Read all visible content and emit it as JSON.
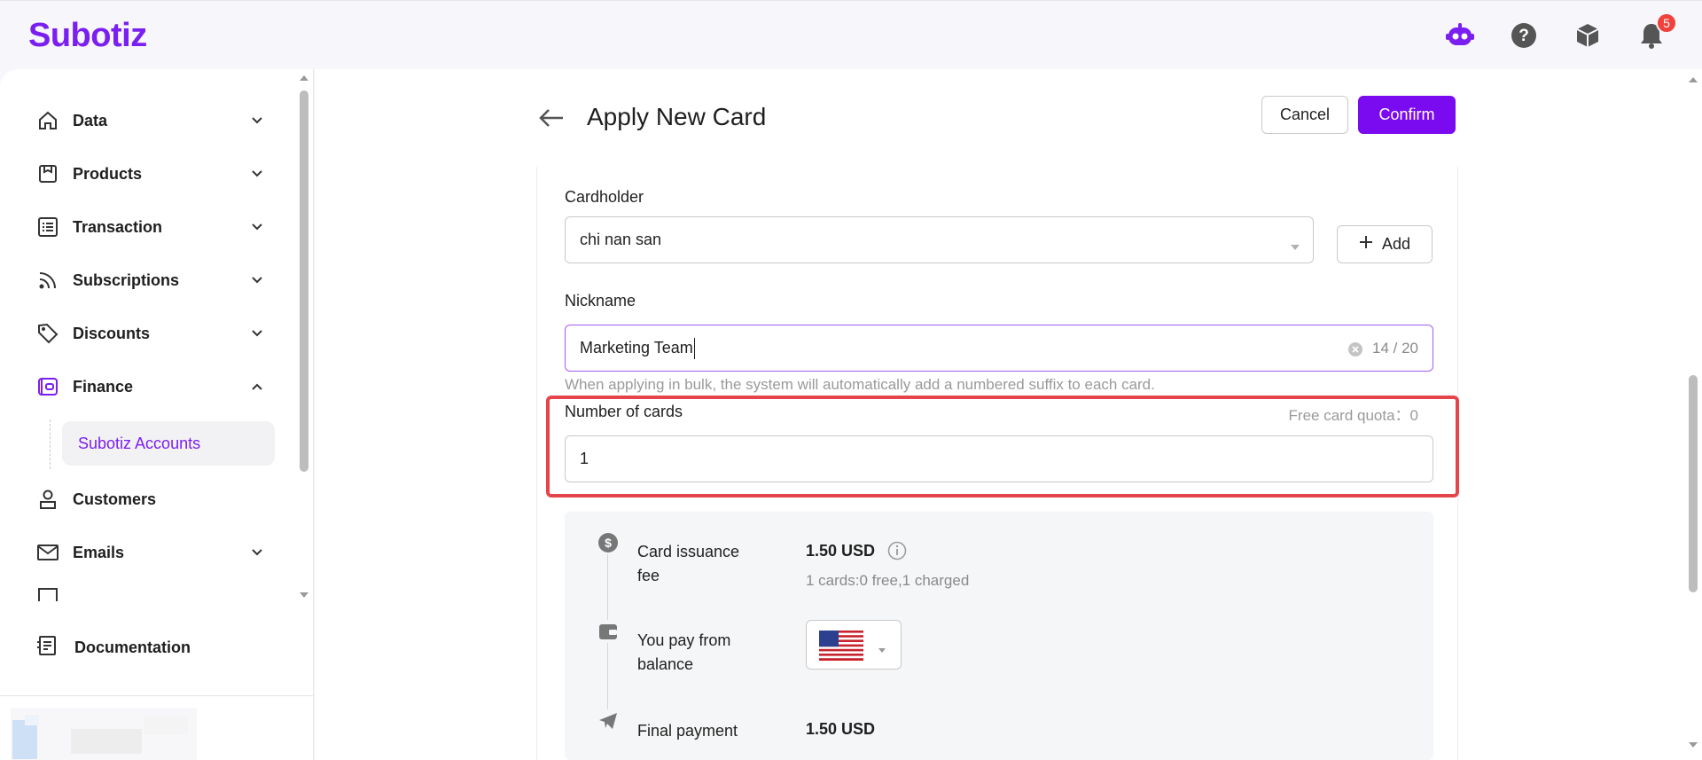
{
  "header": {
    "logo": "Subotiz",
    "notification_count": "5",
    "accent_color": "#7a1ff0",
    "icons": [
      "assistant-bot-icon",
      "help-icon",
      "package-icon",
      "bell-icon"
    ]
  },
  "sidebar": {
    "items": [
      {
        "label": "Data",
        "icon": "home-icon"
      },
      {
        "label": "Products",
        "icon": "store-icon"
      },
      {
        "label": "Transaction",
        "icon": "list-icon"
      },
      {
        "label": "Subscriptions",
        "icon": "rss-icon"
      },
      {
        "label": "Discounts",
        "icon": "tag-icon"
      },
      {
        "label": "Finance",
        "icon": "wallet-icon"
      },
      {
        "label": "Customers",
        "icon": "user-icon"
      },
      {
        "label": "Emails",
        "icon": "mail-icon"
      }
    ],
    "sub_item": "Subotiz Accounts",
    "documentation": "Documentation"
  },
  "page": {
    "title": "Apply New Card",
    "cancel": "Cancel",
    "confirm": "Confirm"
  },
  "form": {
    "cardholder_label": "Cardholder",
    "cardholder_value": "chi nan san",
    "add_label": "Add",
    "nickname_label": "Nickname",
    "nickname_value": "Marketing Team",
    "nickname_count": "14 / 20",
    "nickname_hint": "When applying in bulk, the system will automatically add a numbered suffix to each card.",
    "cards_label": "Number of cards",
    "quota": "Free card quota：0",
    "cards_value": "1"
  },
  "fees": {
    "issuance_label": "Card issuance fee",
    "issuance_value": "1.50 USD",
    "issuance_detail": "1 cards:0 free,1 charged",
    "pay_from_label": "You pay from balance",
    "final_label": "Final payment",
    "final_value": "1.50 USD"
  }
}
